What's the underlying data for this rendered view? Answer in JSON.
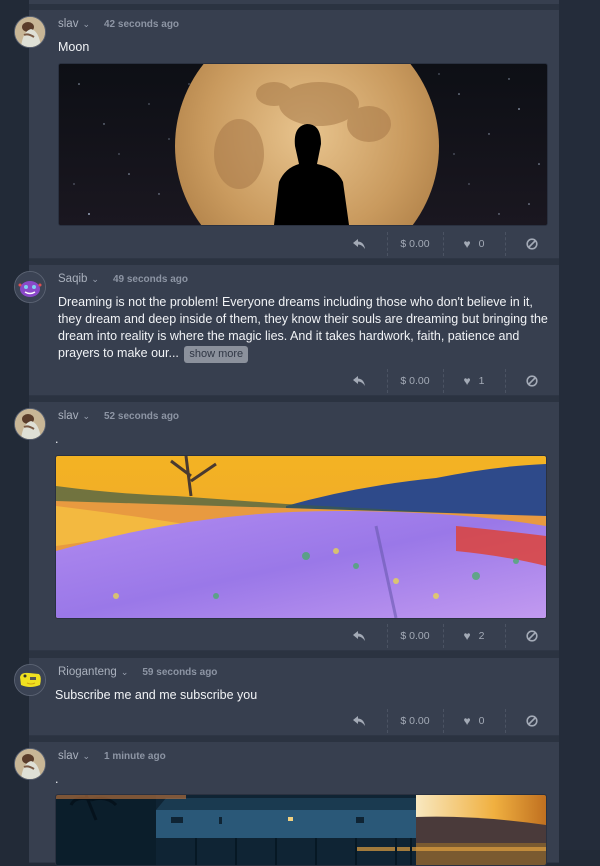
{
  "posts": [
    {
      "user": "slav",
      "time": "42 seconds ago",
      "text": "Moon",
      "media": "moon-silhouette-image",
      "tip": "$ 0.00",
      "likes": "0"
    },
    {
      "user": "Saqib",
      "time": "49 seconds ago",
      "text": "Dreaming is not the problem! Everyone dreams including those who don't believe in it, they dream and deep inside of them, they know their souls are dreaming but bringing the dream into reality is where the magic lies. And it takes hardwork, faith, patience and prayers to make our...",
      "show_more": "show more",
      "tip": "$ 0.00",
      "likes": "1"
    },
    {
      "user": "slav",
      "time": "52 seconds ago",
      "text": ".",
      "media": "lavender-field-painting",
      "tip": "$ 0.00",
      "likes": "2"
    },
    {
      "user": "Rioganteng",
      "time": "59 seconds ago",
      "text": "Subscribe me and me subscribe you",
      "tip": "$ 0.00",
      "likes": "0"
    },
    {
      "user": "slav",
      "time": "1 minute ago",
      "text": ".",
      "media": "pier-sunset-photo"
    }
  ],
  "icons": {
    "chevron": "⌄",
    "heart": "♥"
  }
}
